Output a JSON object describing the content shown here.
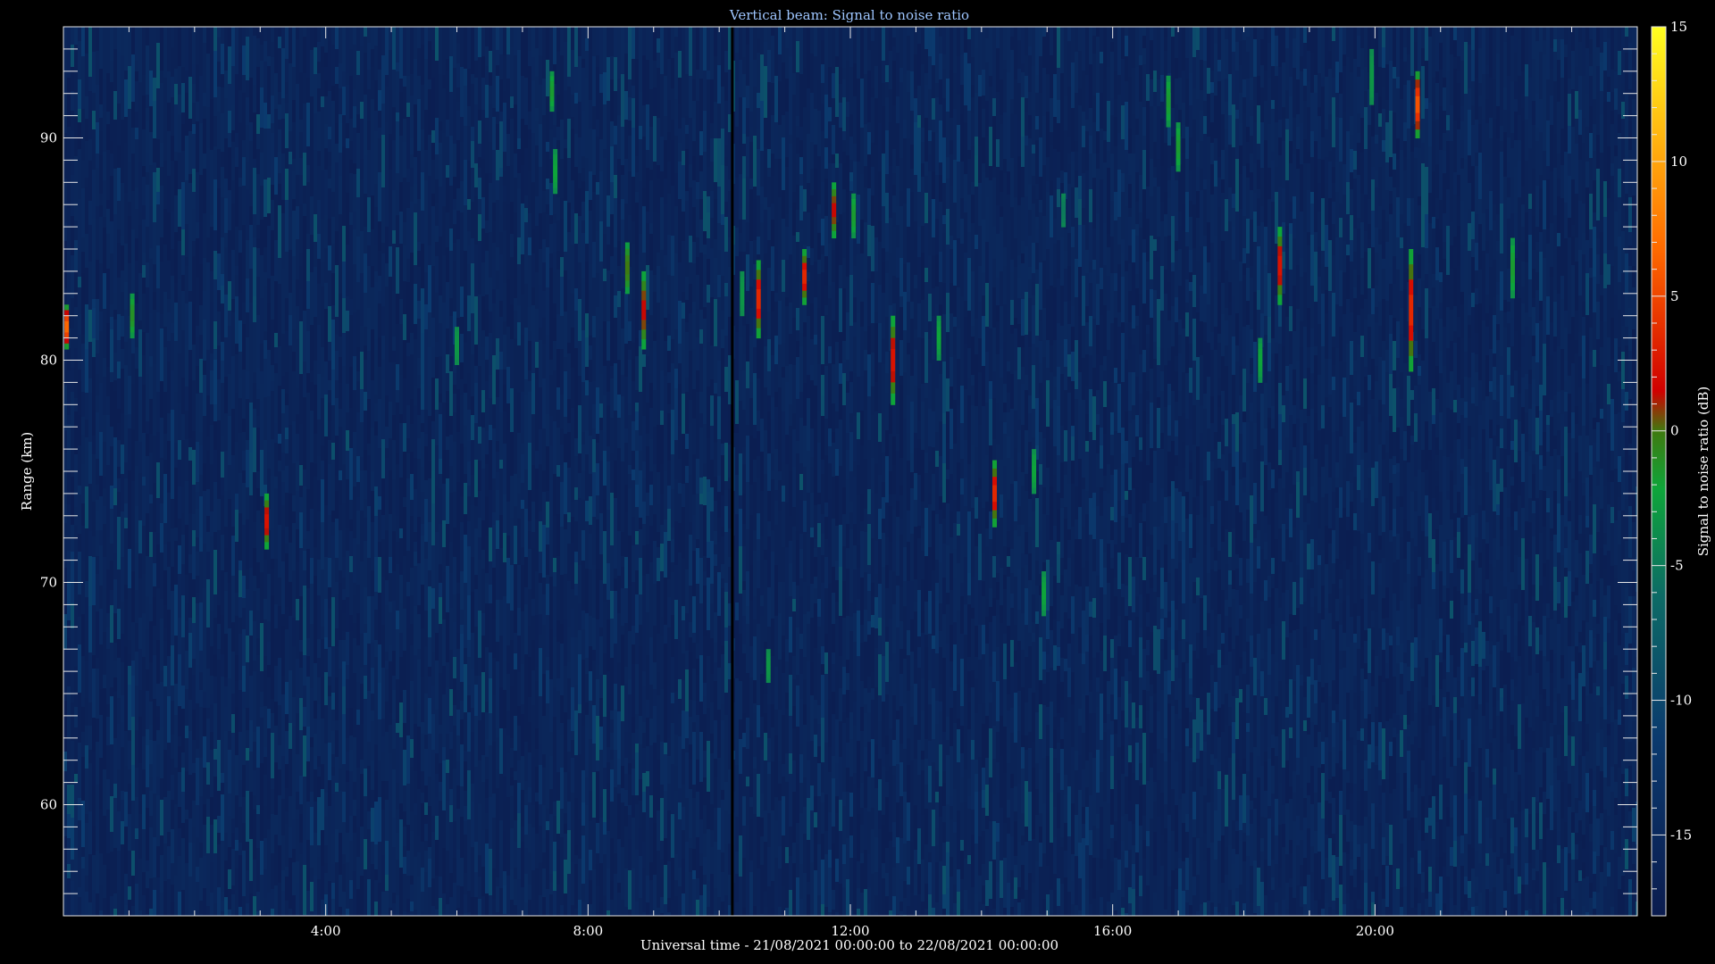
{
  "chart_data": {
    "type": "heatmap",
    "title": "Vertical beam: Signal to noise ratio",
    "xlabel": "Universal time - 21/08/2021 00:00:00 to 22/08/2021 00:00:00",
    "ylabel": "Range (km)",
    "colorbar_label": "Signal to noise ratio (dB)",
    "x_ticks": [
      "4:00",
      "8:00",
      "12:00",
      "16:00",
      "20:00"
    ],
    "x_tick_hours": [
      4,
      8,
      12,
      16,
      20
    ],
    "xlim_hours": [
      0,
      24
    ],
    "y_ticks": [
      60,
      70,
      80,
      90
    ],
    "ylim_km": [
      55,
      95
    ],
    "colorbar_ticks": [
      15,
      10,
      5,
      0,
      -5,
      -10,
      -15
    ],
    "clim_db": [
      -18,
      15
    ],
    "background_snr_db": -17,
    "data_gap_hour": 10.2,
    "echoes": [
      {
        "hour": 0.05,
        "range_min": 80.5,
        "range_max": 82.5,
        "peak_db": 5
      },
      {
        "hour": 1.05,
        "range_min": 81.0,
        "range_max": 83.0,
        "peak_db": -4
      },
      {
        "hour": 3.1,
        "range_min": 71.5,
        "range_max": 74.0,
        "peak_db": 1
      },
      {
        "hour": 6.0,
        "range_min": 79.8,
        "range_max": 81.5,
        "peak_db": -7
      },
      {
        "hour": 7.45,
        "range_min": 91.2,
        "range_max": 93.0,
        "peak_db": -5
      },
      {
        "hour": 7.5,
        "range_min": 87.5,
        "range_max": 89.5,
        "peak_db": -6
      },
      {
        "hour": 8.6,
        "range_min": 83.0,
        "range_max": 85.3,
        "peak_db": -2
      },
      {
        "hour": 8.85,
        "range_min": 80.5,
        "range_max": 84.0,
        "peak_db": 0
      },
      {
        "hour": 10.35,
        "range_min": 82.0,
        "range_max": 84.0,
        "peak_db": -7
      },
      {
        "hour": 10.6,
        "range_min": 81.0,
        "range_max": 84.5,
        "peak_db": 2
      },
      {
        "hour": 10.75,
        "range_min": 65.5,
        "range_max": 67.0,
        "peak_db": -7
      },
      {
        "hour": 11.3,
        "range_min": 82.5,
        "range_max": 85.0,
        "peak_db": 2
      },
      {
        "hour": 11.75,
        "range_min": 85.5,
        "range_max": 88.0,
        "peak_db": 0
      },
      {
        "hour": 12.05,
        "range_min": 85.5,
        "range_max": 87.5,
        "peak_db": -5
      },
      {
        "hour": 12.65,
        "range_min": 78.0,
        "range_max": 82.0,
        "peak_db": 1
      },
      {
        "hour": 13.35,
        "range_min": 80.0,
        "range_max": 82.0,
        "peak_db": -6
      },
      {
        "hour": 14.2,
        "range_min": 72.5,
        "range_max": 75.5,
        "peak_db": 2
      },
      {
        "hour": 14.8,
        "range_min": 74.0,
        "range_max": 76.0,
        "peak_db": -6
      },
      {
        "hour": 14.95,
        "range_min": 68.5,
        "range_max": 70.5,
        "peak_db": -6
      },
      {
        "hour": 15.25,
        "range_min": 86.0,
        "range_max": 87.5,
        "peak_db": -9
      },
      {
        "hour": 16.85,
        "range_min": 90.5,
        "range_max": 92.8,
        "peak_db": -5
      },
      {
        "hour": 17.0,
        "range_min": 88.5,
        "range_max": 90.7,
        "peak_db": -5
      },
      {
        "hour": 18.25,
        "range_min": 79.0,
        "range_max": 81.0,
        "peak_db": -6
      },
      {
        "hour": 18.55,
        "range_min": 82.5,
        "range_max": 86.0,
        "peak_db": 1
      },
      {
        "hour": 19.95,
        "range_min": 91.5,
        "range_max": 94.0,
        "peak_db": -7
      },
      {
        "hour": 20.55,
        "range_min": 79.5,
        "range_max": 85.0,
        "peak_db": 2
      },
      {
        "hour": 20.65,
        "range_min": 90.0,
        "range_max": 93.0,
        "peak_db": 4
      },
      {
        "hour": 22.1,
        "range_min": 82.8,
        "range_max": 85.5,
        "peak_db": -5
      }
    ]
  }
}
